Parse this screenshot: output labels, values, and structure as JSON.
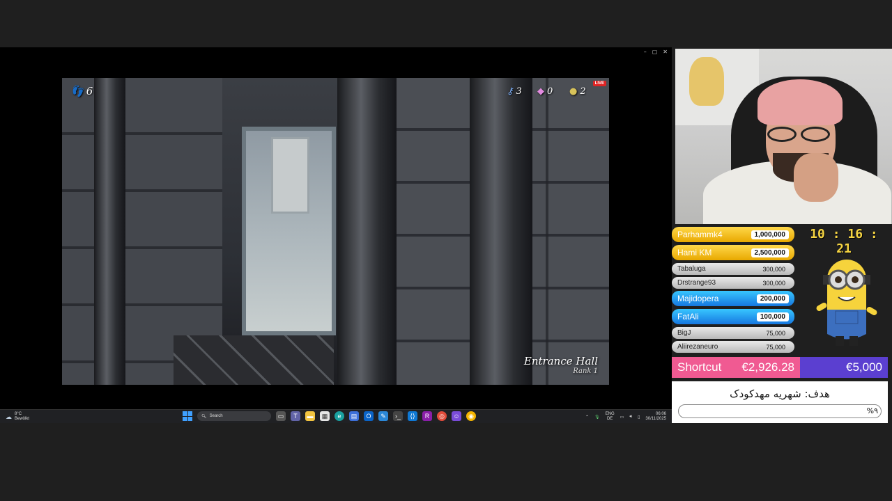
{
  "window": {
    "controls": [
      "–",
      "▢",
      "✕"
    ]
  },
  "game": {
    "steps": "6",
    "keys": "3",
    "gems": "0",
    "coins": "2",
    "live_badge": "LIVE",
    "location": "Entrance Hall",
    "rank": "Rank 1"
  },
  "taskbar": {
    "weather_temp": "8°C",
    "weather_desc": "Bewölkt",
    "search_placeholder": "Search",
    "lang_top": "ENG",
    "lang_bottom": "DE",
    "time": "06:06",
    "date": "30/11/2025"
  },
  "stream": {
    "timer": "10 : 16 : 21",
    "leaderboard": [
      {
        "name": "Parhammk4",
        "amount": "1,000,000",
        "style": "gold"
      },
      {
        "name": "Hami KM",
        "amount": "2,500,000",
        "style": "gold"
      },
      {
        "name": "Tabaluga",
        "amount": "300,000",
        "style": "small"
      },
      {
        "name": "Drstrange93",
        "amount": "300,000",
        "style": "small"
      },
      {
        "name": "Majidopera",
        "amount": "200,000",
        "style": "blue"
      },
      {
        "name": "FatAli",
        "amount": "100,000",
        "style": "blue"
      },
      {
        "name": "BigJ",
        "amount": "75,000",
        "style": "small"
      },
      {
        "name": "Aliirezaneuro",
        "amount": "75,000",
        "style": "small"
      }
    ],
    "shortcut_label": "Shortcut",
    "shortcut_current": "€2,926.28",
    "shortcut_goal": "€5,000",
    "goal_text": "هدف: شهریه مهدکودک",
    "goal_percent": "%۹"
  }
}
